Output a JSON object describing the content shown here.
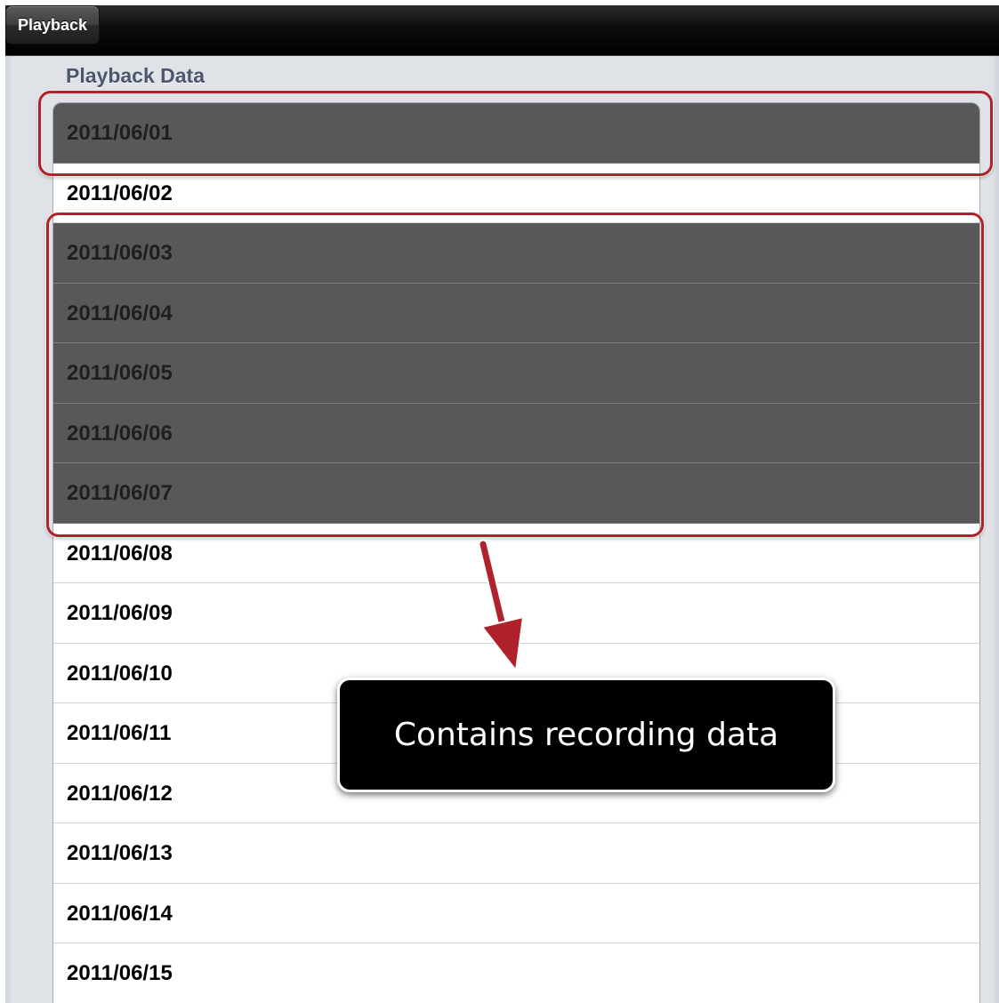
{
  "navbar": {
    "back_label": "Playback"
  },
  "section": {
    "header": "Playback Data"
  },
  "rows": [
    {
      "label": "2011/06/01",
      "recorded": true
    },
    {
      "label": "2011/06/02",
      "recorded": false
    },
    {
      "label": "2011/06/03",
      "recorded": true
    },
    {
      "label": "2011/06/04",
      "recorded": true
    },
    {
      "label": "2011/06/05",
      "recorded": true
    },
    {
      "label": "2011/06/06",
      "recorded": true
    },
    {
      "label": "2011/06/07",
      "recorded": true
    },
    {
      "label": "2011/06/08",
      "recorded": false
    },
    {
      "label": "2011/06/09",
      "recorded": false
    },
    {
      "label": "2011/06/10",
      "recorded": false
    },
    {
      "label": "2011/06/11",
      "recorded": false
    },
    {
      "label": "2011/06/12",
      "recorded": false
    },
    {
      "label": "2011/06/13",
      "recorded": false
    },
    {
      "label": "2011/06/14",
      "recorded": false
    },
    {
      "label": "2011/06/15",
      "recorded": false
    }
  ],
  "callout": {
    "text": "Contains recording data"
  },
  "colors": {
    "recorded_row": "#585858",
    "highlight_border": "#b0222b",
    "callout_bg": "#000000",
    "section_header": "#4c566c"
  }
}
